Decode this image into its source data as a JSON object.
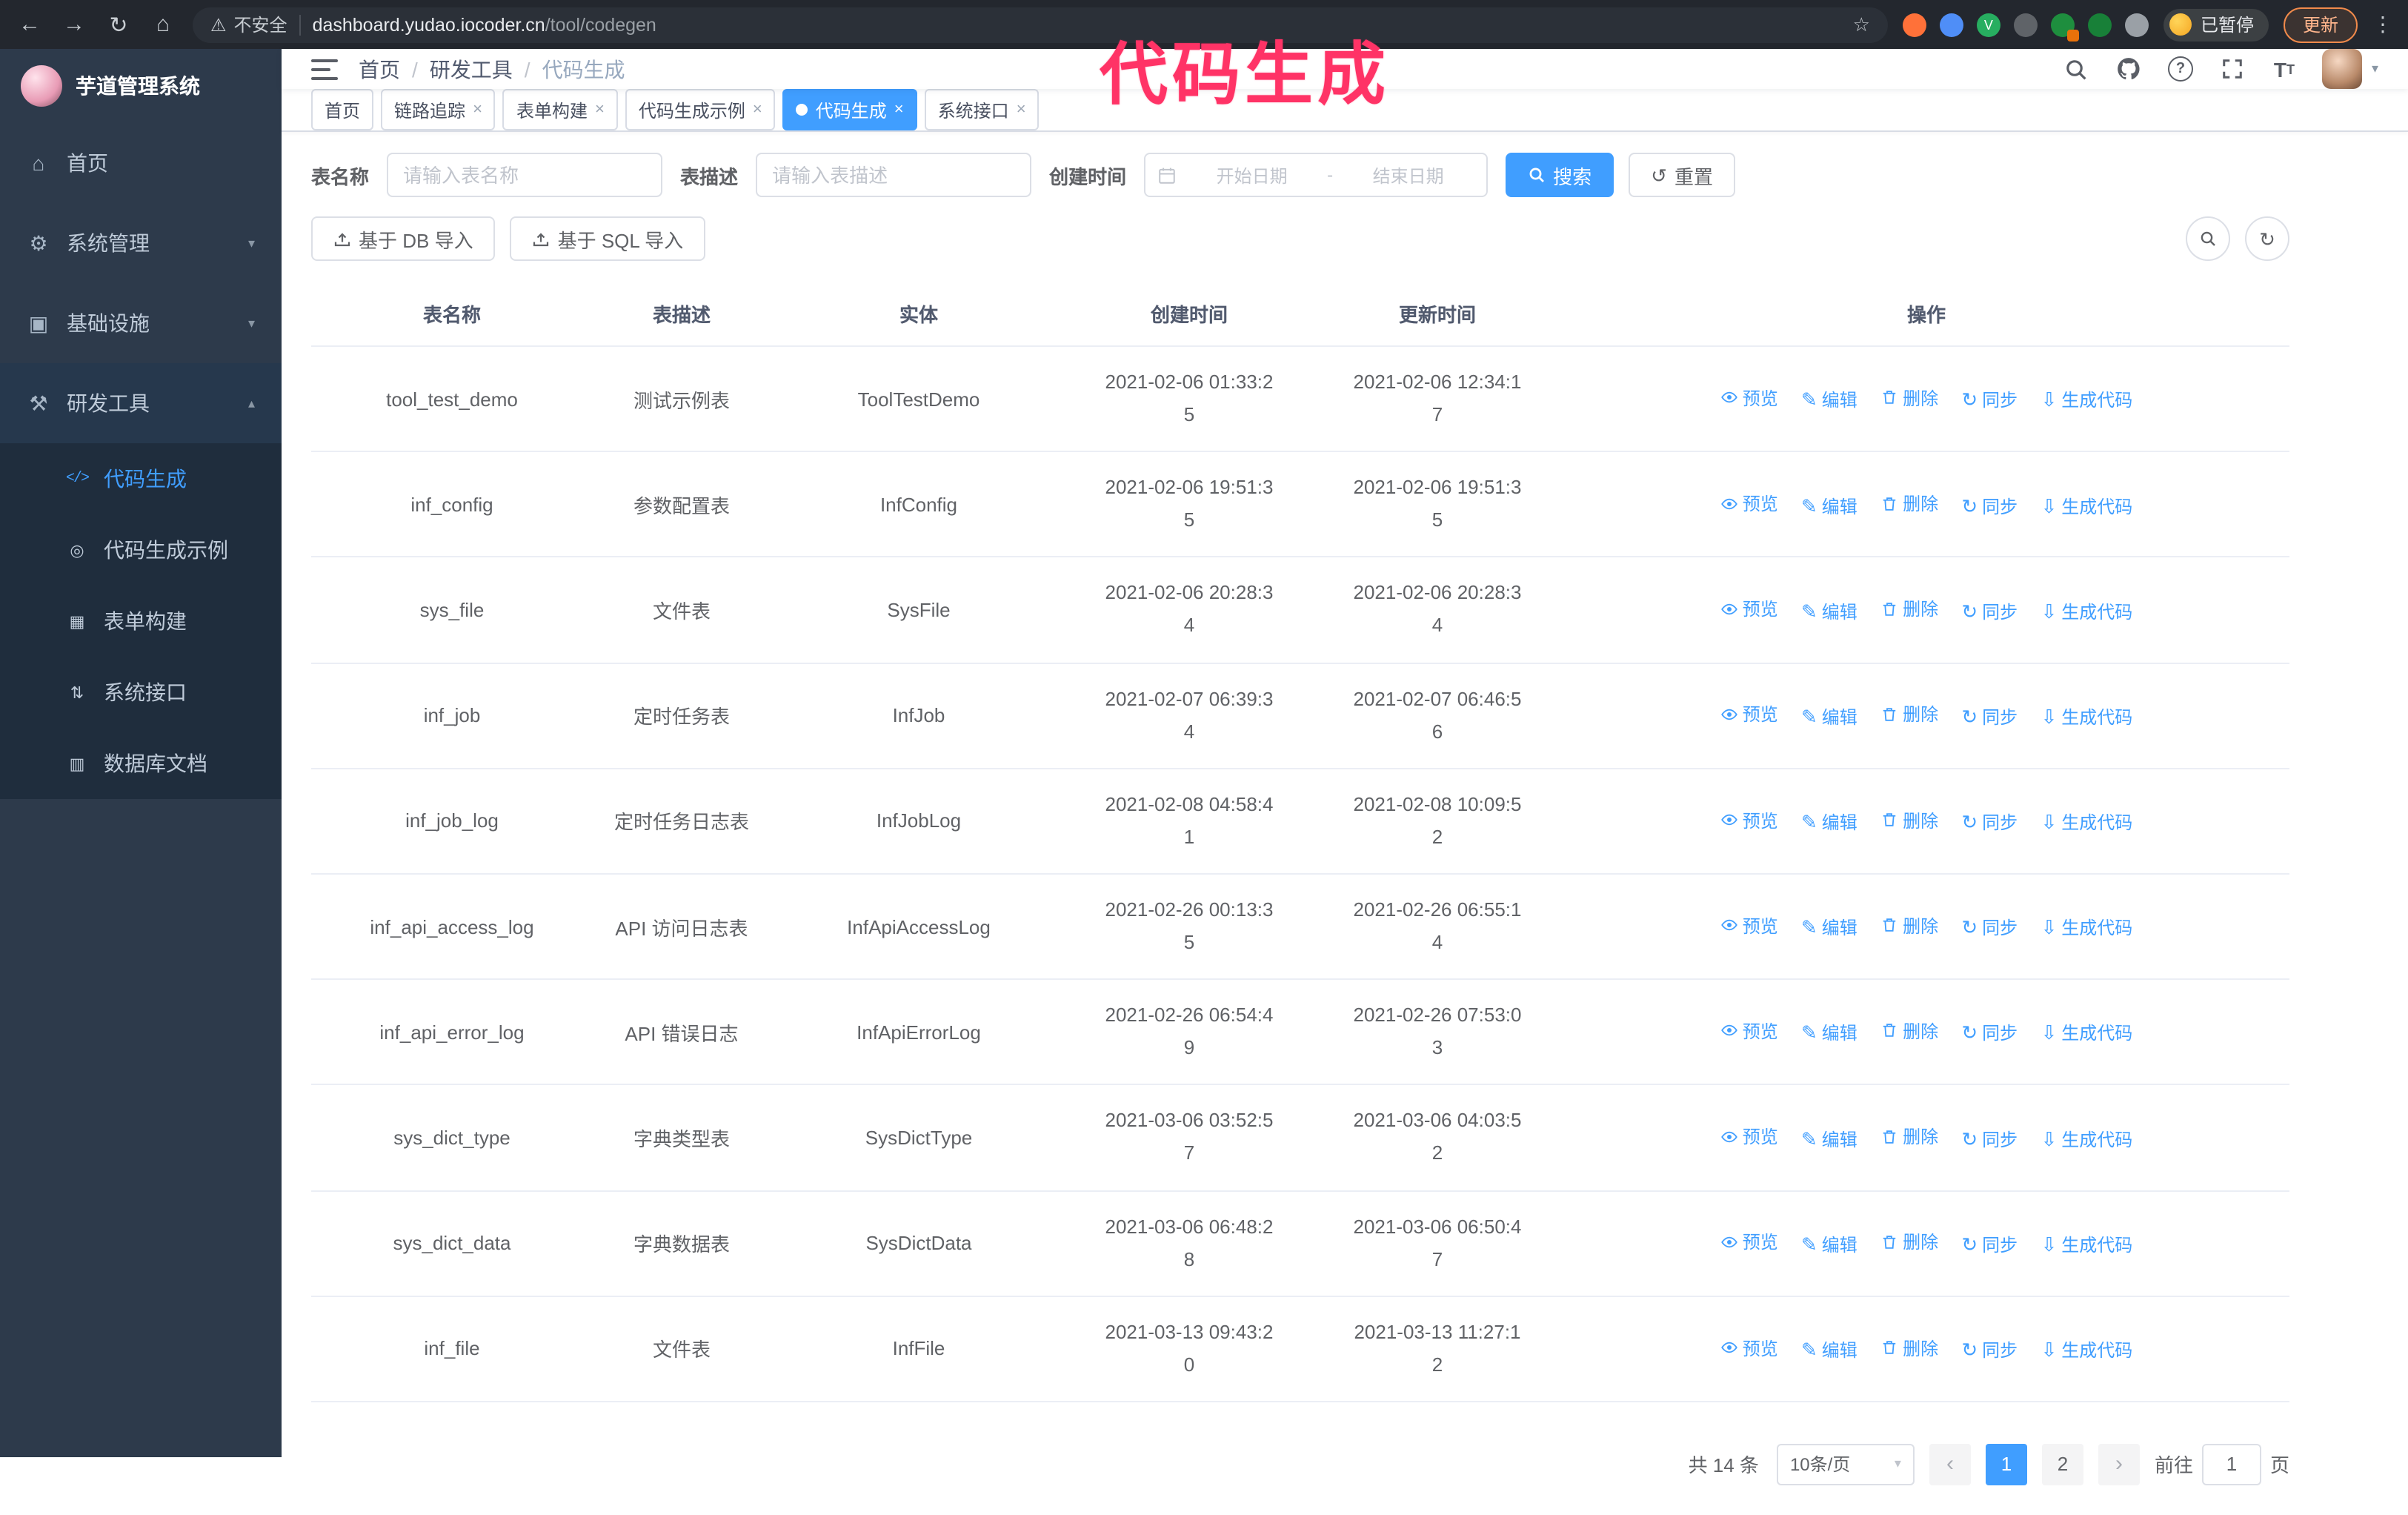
{
  "colors": {
    "accent": "#409eff",
    "annotation": "#ff3366",
    "sidebar_bg": "#2d3a4b",
    "submenu_bg": "#1f2d3d",
    "active_tab_bg": "#409eff"
  },
  "browser": {
    "security_warning": "不安全",
    "url_host": "dashboard.yudao.iocoder.cn",
    "url_path": "/tool/codegen",
    "paused_badge": "已暂停",
    "update_button": "更新"
  },
  "annotation": {
    "text": "代码生成"
  },
  "sidebar": {
    "logo_title": "芋道管理系统",
    "items": [
      {
        "label": "首页",
        "icon": "home-icon",
        "expandable": false
      },
      {
        "label": "系统管理",
        "icon": "gear-icon",
        "expandable": true
      },
      {
        "label": "基础设施",
        "icon": "infrastructure-icon",
        "expandable": true
      },
      {
        "label": "研发工具",
        "icon": "tools-icon",
        "expandable": true,
        "expanded": true
      }
    ],
    "subitems": [
      {
        "label": "代码生成",
        "icon": "code-icon",
        "active": true
      },
      {
        "label": "代码生成示例",
        "icon": "example-icon"
      },
      {
        "label": "表单构建",
        "icon": "form-builder-icon"
      },
      {
        "label": "系统接口",
        "icon": "api-icon"
      },
      {
        "label": "数据库文档",
        "icon": "database-doc-icon"
      }
    ]
  },
  "header": {
    "breadcrumb": [
      "首页",
      "研发工具",
      "代码生成"
    ]
  },
  "tabs": [
    {
      "label": "首页",
      "closable": false,
      "active": false
    },
    {
      "label": "链路追踪",
      "closable": true,
      "active": false
    },
    {
      "label": "表单构建",
      "closable": true,
      "active": false
    },
    {
      "label": "代码生成示例",
      "closable": true,
      "active": false
    },
    {
      "label": "代码生成",
      "closable": true,
      "active": true
    },
    {
      "label": "系统接口",
      "closable": true,
      "active": false
    }
  ],
  "filters": {
    "table_name_label": "表名称",
    "table_name_placeholder": "请输入表名称",
    "table_desc_label": "表描述",
    "table_desc_placeholder": "请输入表描述",
    "create_time_label": "创建时间",
    "date_start_placeholder": "开始日期",
    "date_separator": "-",
    "date_end_placeholder": "结束日期",
    "search_button": "搜索",
    "reset_button": "重置"
  },
  "toolbar": {
    "import_db": "基于 DB 导入",
    "import_sql": "基于 SQL 导入"
  },
  "table": {
    "columns": [
      "表名称",
      "表描述",
      "实体",
      "创建时间",
      "更新时间",
      "操作"
    ],
    "actions": [
      "预览",
      "编辑",
      "删除",
      "同步",
      "生成代码"
    ],
    "rows": [
      {
        "name": "tool_test_demo",
        "desc": "测试示例表",
        "entity": "ToolTestDemo",
        "created": "2021-02-06 01:33:25",
        "updated": "2021-02-06 12:34:17"
      },
      {
        "name": "inf_config",
        "desc": "参数配置表",
        "entity": "InfConfig",
        "created": "2021-02-06 19:51:35",
        "updated": "2021-02-06 19:51:35"
      },
      {
        "name": "sys_file",
        "desc": "文件表",
        "entity": "SysFile",
        "created": "2021-02-06 20:28:34",
        "updated": "2021-02-06 20:28:34"
      },
      {
        "name": "inf_job",
        "desc": "定时任务表",
        "entity": "InfJob",
        "created": "2021-02-07 06:39:34",
        "updated": "2021-02-07 06:46:56"
      },
      {
        "name": "inf_job_log",
        "desc": "定时任务日志表",
        "entity": "InfJobLog",
        "created": "2021-02-08 04:58:41",
        "updated": "2021-02-08 10:09:52"
      },
      {
        "name": "inf_api_access_log",
        "desc": "API 访问日志表",
        "entity": "InfApiAccessLog",
        "created": "2021-02-26 00:13:35",
        "updated": "2021-02-26 06:55:14"
      },
      {
        "name": "inf_api_error_log",
        "desc": "API 错误日志",
        "entity": "InfApiErrorLog",
        "created": "2021-02-26 06:54:49",
        "updated": "2021-02-26 07:53:03"
      },
      {
        "name": "sys_dict_type",
        "desc": "字典类型表",
        "entity": "SysDictType",
        "created": "2021-03-06 03:52:57",
        "updated": "2021-03-06 04:03:52"
      },
      {
        "name": "sys_dict_data",
        "desc": "字典数据表",
        "entity": "SysDictData",
        "created": "2021-03-06 06:48:28",
        "updated": "2021-03-06 06:50:47"
      },
      {
        "name": "inf_file",
        "desc": "文件表",
        "entity": "InfFile",
        "created": "2021-03-13 09:43:20",
        "updated": "2021-03-13 11:27:12"
      }
    ]
  },
  "pagination": {
    "total": "共 14 条",
    "page_size": "10条/页",
    "pages": [
      "1",
      "2"
    ],
    "active_page": "1",
    "goto_label": "前往",
    "goto_value": "1",
    "page_suffix": "页"
  }
}
